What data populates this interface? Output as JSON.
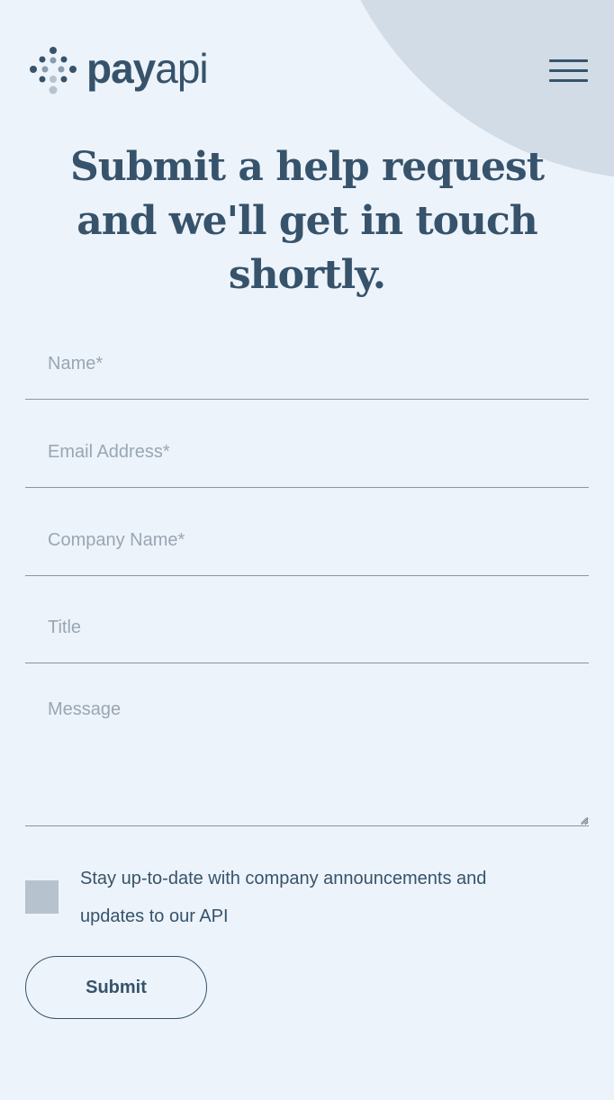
{
  "brand": {
    "name_bold": "pay",
    "name_light": "api"
  },
  "header": {
    "menu_icon": "hamburger-menu-icon"
  },
  "hero": {
    "title": "Submit a help request and we'll get in touch shortly."
  },
  "form": {
    "fields": {
      "name": {
        "placeholder": "Name*",
        "value": ""
      },
      "email": {
        "placeholder": "Email Address*",
        "value": ""
      },
      "company": {
        "placeholder": "Company Name*",
        "value": ""
      },
      "title": {
        "placeholder": "Title",
        "value": ""
      },
      "message": {
        "placeholder": "Message",
        "value": ""
      }
    },
    "newsletter": {
      "checked": false,
      "label": "Stay up-to-date with company announcements and updates to our API"
    },
    "submit_label": "Submit"
  },
  "colors": {
    "background": "#edf3fa",
    "primary": "#36536b",
    "decor": "#d2dce6",
    "checkbox": "#b6c3ce",
    "placeholder": "#99a6b3"
  }
}
